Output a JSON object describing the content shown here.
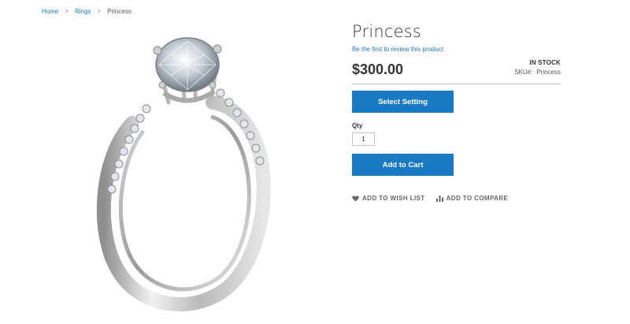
{
  "breadcrumb": {
    "items": [
      {
        "label": "Home"
      },
      {
        "label": "Rings"
      }
    ],
    "separator": ">",
    "current": "Princess"
  },
  "product": {
    "title": "Princess",
    "review_link": "Be the first to review this product",
    "price": "$300.00",
    "stock": "IN STOCK",
    "sku_label": "SKU#:",
    "sku_value": "Princess",
    "image": "ring-image"
  },
  "buttons": {
    "select_setting": "Select Setting",
    "add_to_cart": "Add to Cart"
  },
  "qty": {
    "label": "Qty",
    "value": "1"
  },
  "actions": {
    "wish_list": {
      "label": "ADD TO WISH LIST",
      "icon": "heart-icon"
    },
    "compare": {
      "label": "ADD TO COMPARE",
      "icon": "bar-chart-icon"
    }
  },
  "colors": {
    "primary": "#1979c3",
    "link": "#1979c3",
    "text": "#333333"
  }
}
